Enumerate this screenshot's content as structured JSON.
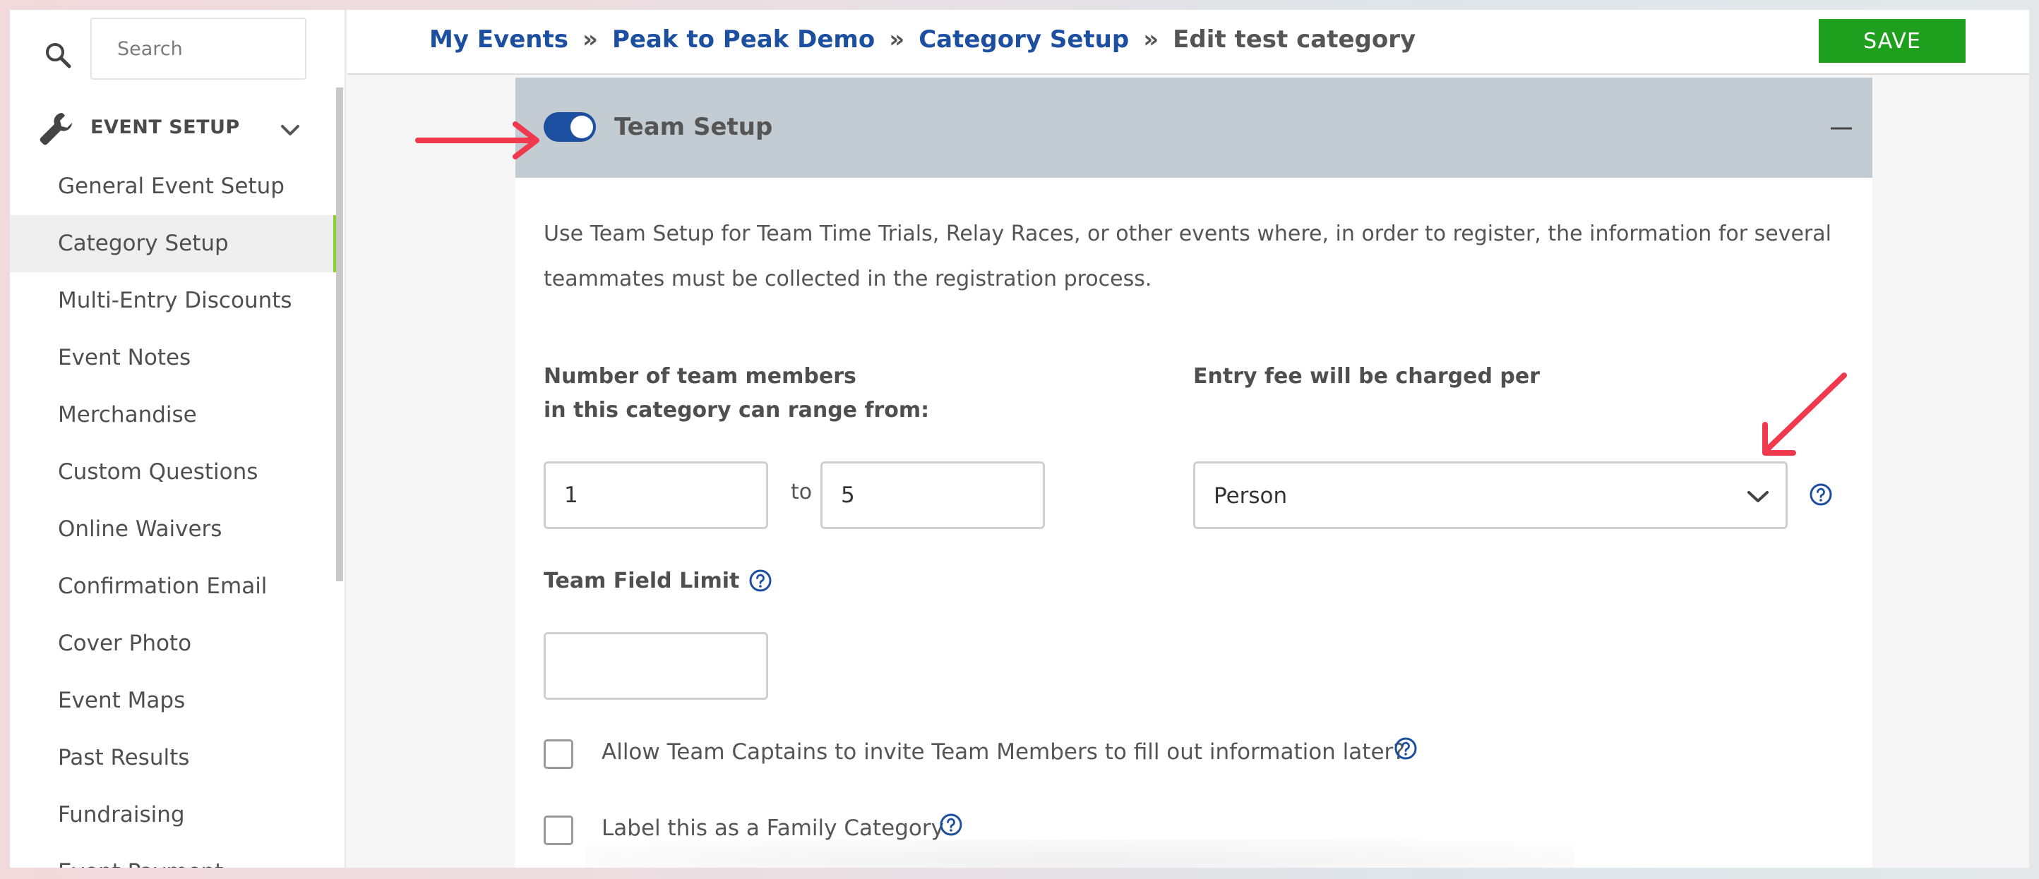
{
  "sidebar": {
    "search": {
      "placeholder": "Search"
    },
    "section": {
      "title": "EVENT SETUP"
    },
    "items": [
      {
        "label": "General Event Setup"
      },
      {
        "label": "Category Setup"
      },
      {
        "label": "Multi-Entry Discounts"
      },
      {
        "label": "Event Notes"
      },
      {
        "label": "Merchandise"
      },
      {
        "label": "Custom Questions"
      },
      {
        "label": "Online Waivers"
      },
      {
        "label": "Confirmation Email"
      },
      {
        "label": "Cover Photo"
      },
      {
        "label": "Event Maps"
      },
      {
        "label": "Past Results"
      },
      {
        "label": "Fundraising"
      },
      {
        "label": "Event Payment"
      }
    ],
    "active_item": "Category Setup"
  },
  "breadcrumb": {
    "links": [
      "My Events",
      "Peak to Peak Demo",
      "Category Setup"
    ],
    "separator": "»",
    "current": "Edit test category"
  },
  "toolbar": {
    "save_label": "SAVE"
  },
  "team_setup": {
    "title": "Team Setup",
    "enabled": true,
    "description": "Use Team Setup for Team Time Trials, Relay Races, or other events where, in order to register, the information for several teammates must be collected in the registration process.",
    "range_label_line1": "Number of team members",
    "range_label_line2": "in this category can range from:",
    "range_min": "1",
    "range_to": "to",
    "range_max": "5",
    "fee_label": "Entry fee will be charged per",
    "fee_value": "Person",
    "field_limit_label": "Team Field Limit",
    "field_limit_value": "",
    "invite_label": "Allow Team Captains to invite Team Members to fill out information later?",
    "invite_checked": false,
    "family_label": "Label this as a Family Category",
    "family_checked": false
  },
  "colors": {
    "link": "#1c4f9f",
    "save": "#1ea01e",
    "active_indicator": "#8ccf2e",
    "panel_header": "#c3cbd3",
    "annotation_arrow": "#f0394d"
  },
  "icons": {
    "search": "search-icon",
    "wrench": "wrench-icon",
    "chevron": "chevron-down-icon",
    "collapse": "minus-icon",
    "help": "help-circle-icon"
  }
}
